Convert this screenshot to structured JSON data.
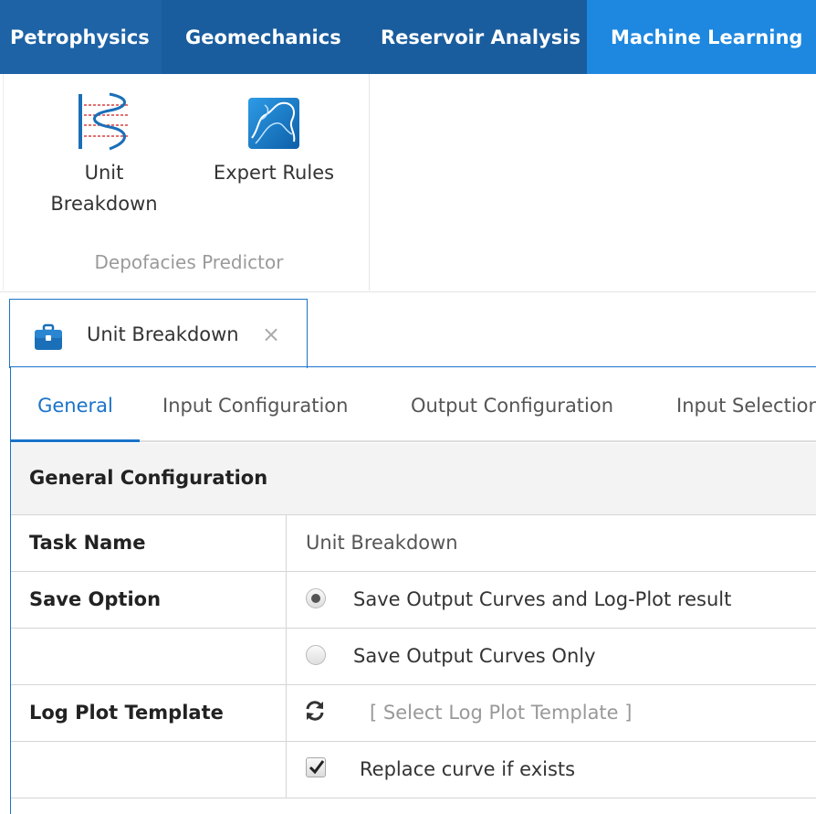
{
  "top_tabs": [
    "Petrophysics",
    "Geomechanics",
    "Reservoir Analysis",
    "Machine Learning"
  ],
  "ribbon": {
    "buttons": [
      {
        "line1": "Unit",
        "line2": "Breakdown",
        "icon": "unit-breakdown-icon"
      },
      {
        "line1": "Expert Rules",
        "line2": "",
        "icon": "expert-rules-icon"
      }
    ],
    "group_label": "Depofacies Predictor"
  },
  "document_tab": {
    "title": "Unit Breakdown",
    "icon": "briefcase-icon",
    "close": "×"
  },
  "sub_tabs": [
    "General",
    "Input Configuration",
    "Output Configuration",
    "Input Selection"
  ],
  "section_title": "General Configuration",
  "form": {
    "task_name_label": "Task Name",
    "task_name_value": "Unit Breakdown",
    "save_option_label": "Save Option",
    "save_options": [
      "Save Output Curves and Log-Plot result",
      "Save Output Curves Only"
    ],
    "log_plot_label": "Log Plot Template",
    "log_plot_placeholder": "[ Select Log Plot Template ]",
    "replace_label": "Replace curve if exists"
  },
  "colors": {
    "ribbon_blue": "#1a5d9e",
    "active_tab": "#1e88e0",
    "accent": "#1a73c9"
  }
}
